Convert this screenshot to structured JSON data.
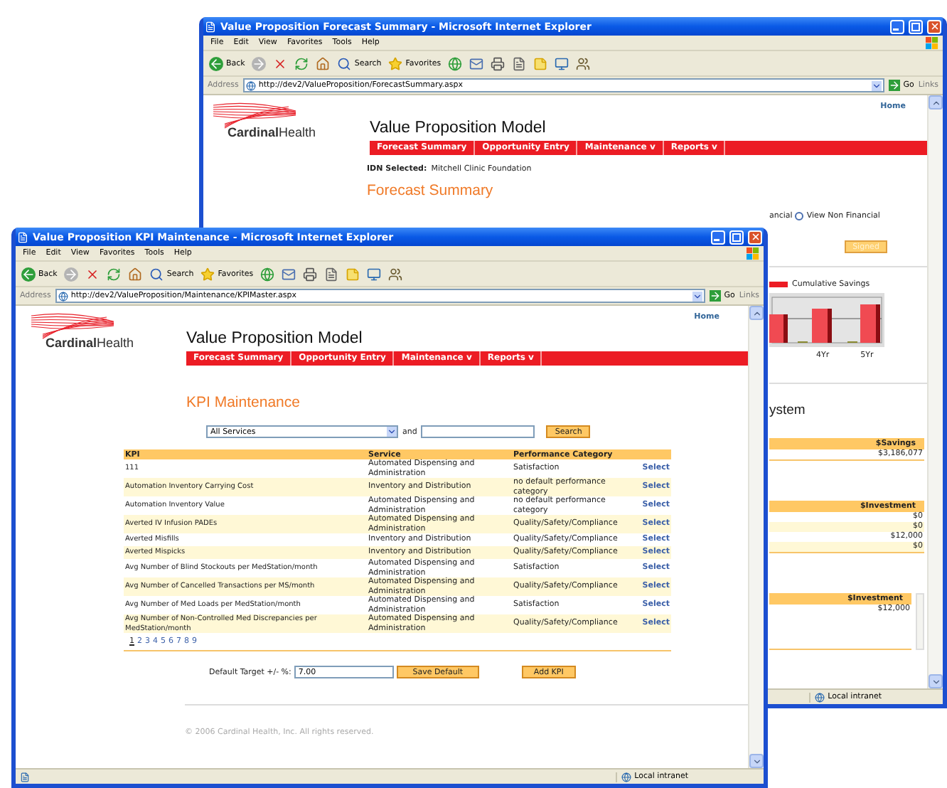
{
  "back_window": {
    "title": "Value Proposition Forecast Summary - Microsoft Internet Explorer",
    "menu": [
      "File",
      "Edit",
      "View",
      "Favorites",
      "Tools",
      "Help"
    ],
    "toolbar": {
      "back": "Back",
      "search": "Search",
      "favorites": "Favorites"
    },
    "address": {
      "label": "Address",
      "url": "http://dev2/ValueProposition/ForecastSummary.aspx",
      "go": "Go",
      "links": "Links"
    },
    "page": {
      "home": "Home",
      "logo": "**Cardinal**Health",
      "app_title": "Value Proposition Model",
      "nav": [
        "Forecast Summary",
        "Opportunity Entry",
        "Maintenance v",
        "Reports v"
      ],
      "idn_label": "IDN Selected:",
      "idn_value": "Mitchell Clinic Foundation",
      "heading": "Forecast Summary",
      "option_tail": "ancial",
      "radio": {
        "label": "View Non Financial",
        "selected": false
      },
      "signed_button": {
        "label": "Signed",
        "disabled": true
      },
      "legend": "Cumulative Savings",
      "chart_labels": [
        "4Yr",
        "5Yr"
      ],
      "section_heading": "ystem",
      "tables": [
        {
          "header": "$Savings",
          "rows": [
            "$3,186,077"
          ]
        },
        {
          "header": "$Investment",
          "rows": [
            "$0",
            "$0",
            "$12,000",
            "$0"
          ]
        },
        {
          "header": "$Investment",
          "rows": [
            "$12,000"
          ]
        }
      ]
    },
    "status": "Local intranet"
  },
  "front_window": {
    "title": "Value Proposition KPI Maintenance - Microsoft Internet Explorer",
    "menu": [
      "File",
      "Edit",
      "View",
      "Favorites",
      "Tools",
      "Help"
    ],
    "toolbar": {
      "back": "Back",
      "search": "Search",
      "favorites": "Favorites"
    },
    "address": {
      "label": "Address",
      "url": "http://dev2/ValueProposition/Maintenance/KPIMaster.aspx",
      "go": "Go",
      "links": "Links"
    },
    "page": {
      "home": "Home",
      "logo": "**Cardinal**Health",
      "app_title": "Value Proposition Model",
      "nav": [
        "Forecast Summary",
        "Opportunity Entry",
        "Maintenance v",
        "Reports v"
      ],
      "heading": "KPI Maintenance",
      "service_select": "All Services",
      "and_label": "and",
      "search_button": "Search",
      "columns": [
        "KPI",
        "Service",
        "Performance Category"
      ],
      "rows": [
        {
          "kpi": "111",
          "service": "Automated Dispensing and Administration",
          "category": "Satisfaction",
          "action": "Select"
        },
        {
          "kpi": "Automation Inventory Carrying Cost",
          "service": "Inventory and Distribution",
          "category": "no default performance category",
          "action": "Select"
        },
        {
          "kpi": "Automation Inventory Value",
          "service": "Automated Dispensing and Administration",
          "category": "no default performance category",
          "action": "Select"
        },
        {
          "kpi": "Averted IV Infusion PADEs",
          "service": "Automated Dispensing and Administration",
          "category": "Quality/Safety/Compliance",
          "action": "Select"
        },
        {
          "kpi": "Averted Misfills",
          "service": "Inventory and Distribution",
          "category": "Quality/Safety/Compliance",
          "action": "Select"
        },
        {
          "kpi": "Averted Mispicks",
          "service": "Inventory and Distribution",
          "category": "Quality/Safety/Compliance",
          "action": "Select"
        },
        {
          "kpi": "Avg Number of Blind Stockouts per MedStation/month",
          "service": "Automated Dispensing and Administration",
          "category": "Satisfaction",
          "action": "Select"
        },
        {
          "kpi": "Avg Number of Cancelled Transactions per MS/month",
          "service": "Automated Dispensing and Administration",
          "category": "Quality/Safety/Compliance",
          "action": "Select"
        },
        {
          "kpi": "Avg Number of Med Loads per MedStation/month",
          "service": "Automated Dispensing and Administration",
          "category": "Satisfaction",
          "action": "Select"
        },
        {
          "kpi": "Avg Number of Non-Controlled Med Discrepancies per MedStation/month",
          "service": "Automated Dispensing and Administration",
          "category": "Quality/Safety/Compliance",
          "action": "Select"
        }
      ],
      "pages": [
        {
          "label": "1",
          "selected": true
        },
        {
          "label": "2",
          "selected": false
        },
        {
          "label": "3",
          "selected": false
        },
        {
          "label": "4",
          "selected": false
        },
        {
          "label": "5",
          "selected": false
        },
        {
          "label": "6",
          "selected": false
        },
        {
          "label": "7",
          "selected": false
        },
        {
          "label": "8",
          "selected": false
        },
        {
          "label": "9",
          "selected": false
        }
      ],
      "target_label": "Default Target +/- %:",
      "target_value": "7.00",
      "save_button": "Save Default",
      "add_button": "Add KPI",
      "copyright": "© 2006 Cardinal Health, Inc. All rights reserved."
    },
    "status": "Local intranet"
  }
}
